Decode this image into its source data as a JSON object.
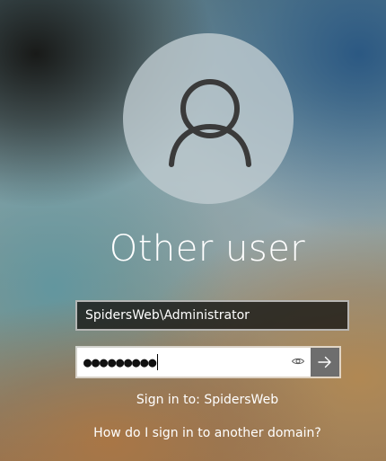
{
  "user": {
    "display_name": "Other user",
    "avatar_icon": "person-icon"
  },
  "username_field": {
    "value": "SpidersWeb\\Administrator"
  },
  "password_field": {
    "masked_value": "●●●●●●●●●",
    "reveal_icon": "eye-icon",
    "submit_icon": "arrow-right-icon"
  },
  "sign_in_target": "Sign in to: SpidersWeb",
  "other_domain_link": "How do I sign in to another domain?"
}
